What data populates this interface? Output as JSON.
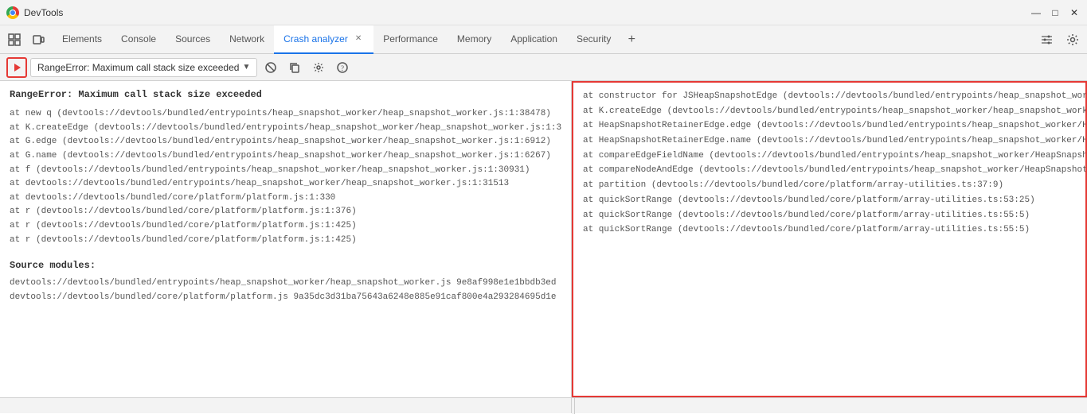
{
  "titlebar": {
    "title": "DevTools",
    "minimize": "—",
    "maximize": "□",
    "close": "✕"
  },
  "tabs": {
    "items": [
      {
        "id": "elements",
        "label": "Elements",
        "active": false,
        "closable": false
      },
      {
        "id": "console",
        "label": "Console",
        "active": false,
        "closable": false
      },
      {
        "id": "sources",
        "label": "Sources",
        "active": false,
        "closable": false
      },
      {
        "id": "network",
        "label": "Network",
        "active": false,
        "closable": false
      },
      {
        "id": "crash-analyzer",
        "label": "Crash analyzer",
        "active": true,
        "closable": true
      },
      {
        "id": "performance",
        "label": "Performance",
        "active": false,
        "closable": false
      },
      {
        "id": "memory",
        "label": "Memory",
        "active": false,
        "closable": false
      },
      {
        "id": "application",
        "label": "Application",
        "active": false,
        "closable": false
      },
      {
        "id": "security",
        "label": "Security",
        "active": false,
        "closable": false
      }
    ],
    "add_label": "+"
  },
  "toolbar": {
    "error_selector": "RangeError: Maximum call stack size exceeded",
    "error_selector_arrow": "▼",
    "stop_icon": "⊘",
    "copy_icon": "⎘",
    "settings_icon": "⚙",
    "help_icon": "?"
  },
  "left_panel": {
    "error_title": "RangeError: Maximum call stack size exceeded",
    "stack_lines": [
      "    at new q (devtools://devtools/bundled/entrypoints/heap_snapshot_worker/heap_snapshot_worker.js:1:38478)",
      "    at K.createEdge (devtools://devtools/bundled/entrypoints/heap_snapshot_worker/heap_snapshot_worker.js:1:3",
      "    at G.edge (devtools://devtools/bundled/entrypoints/heap_snapshot_worker/heap_snapshot_worker.js:1:6912)",
      "    at G.name (devtools://devtools/bundled/entrypoints/heap_snapshot_worker/heap_snapshot_worker.js:1:6267)",
      "    at f (devtools://devtools/bundled/entrypoints/heap_snapshot_worker/heap_snapshot_worker.js:1:30931)",
      "    at devtools://devtools/bundled/entrypoints/heap_snapshot_worker/heap_snapshot_worker.js:1:31513",
      "    at devtools://devtools/bundled/core/platform/platform.js:1:330",
      "    at r (devtools://devtools/bundled/core/platform/platform.js:1:376)",
      "    at r (devtools://devtools/bundled/core/platform/platform.js:1:425)",
      "    at r (devtools://devtools/bundled/core/platform/platform.js:1:425)"
    ],
    "section_title": "Source modules:",
    "source_lines": [
      "    devtools://devtools/bundled/entrypoints/heap_snapshot_worker/heap_snapshot_worker.js 9e8af998e1e1bbdb3ed",
      "    devtools://devtools/bundled/core/platform/platform.js 9a35dc3d31ba75643a6248e885e91caf800e4a293284695d1e"
    ]
  },
  "right_panel": {
    "stack_lines": [
      "at constructor for JSHeapSnapshotEdge (devtools://devtools/bundled/entrypoints/heap_snapshot_wor",
      "at K.createEdge (devtools://devtools/bundled/entrypoints/heap_snapshot_worker/heap_snapshot_worke",
      "at HeapSnapshotRetainerEdge.edge (devtools://devtools/bundled/entrypoints/heap_snapshot_worker/H",
      "at HeapSnapshotRetainerEdge.name (devtools://devtools/bundled/entrypoints/heap_snapshot_worker/H",
      "at compareEdgeFieldName (devtools://devtools/bundled/entrypoints/heap_snapshot_worker/HeapSnapsh",
      "at compareNodeAndEdge (devtools://devtools/bundled/entrypoints/heap_snapshot_worker/HeapSnapshot",
      "at partition (devtools://devtools/bundled/core/platform/array-utilities.ts:37:9)",
      "at quickSortRange (devtools://devtools/bundled/core/platform/array-utilities.ts:53:25)",
      "at quickSortRange (devtools://devtools/bundled/core/platform/array-utilities.ts:55:5)",
      "at quickSortRange (devtools://devtools/bundled/core/platform/array-utilities.ts:55:5)"
    ]
  },
  "colors": {
    "active_tab": "#1a73e8",
    "play_btn_border": "#e53935",
    "right_panel_border": "#e53935"
  }
}
